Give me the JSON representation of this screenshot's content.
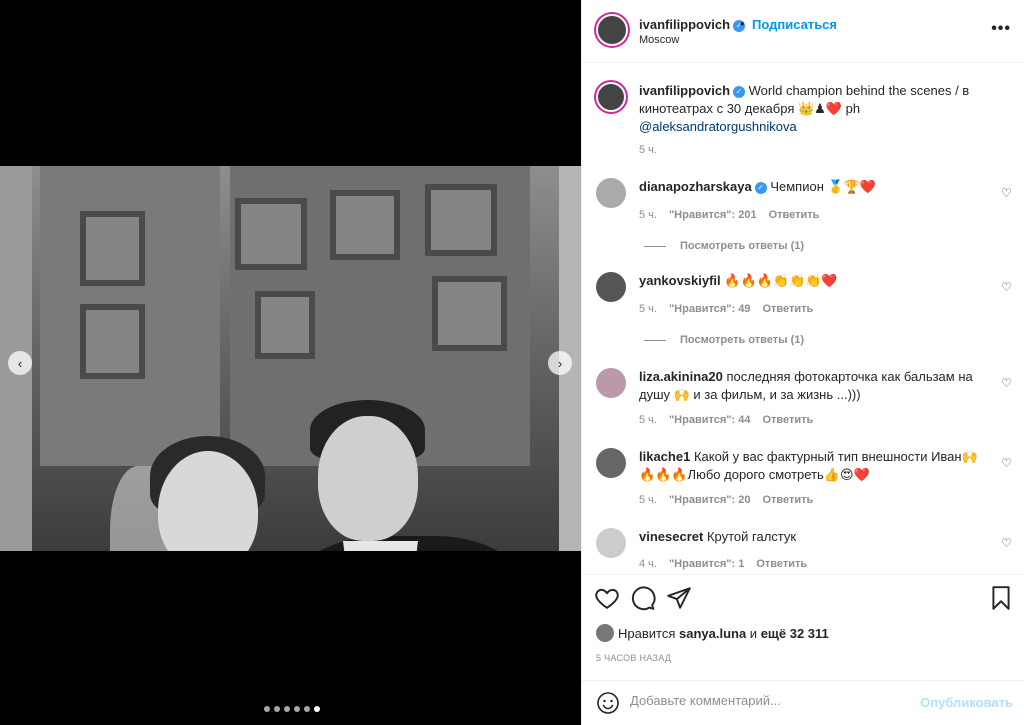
{
  "post": {
    "username": "ivanfilippovich",
    "follow_label": "Подписаться",
    "separator": "•",
    "location": "Moscow",
    "more_label": "•••",
    "nav_prev": "‹",
    "nav_next": "›",
    "carousel": {
      "count": 6,
      "active_index": 5
    }
  },
  "caption": {
    "username": "ivanfilippovich",
    "text": " World champion behind the scenes / в кинотеатрах с 30 декабря 👑♟❤️ ph ",
    "mention": "@aleksandratorgushnikova",
    "time": "5 ч."
  },
  "comments": [
    {
      "username": "dianapozharskaya",
      "verified": true,
      "text": " Чемпион 🥇🏆❤️",
      "time": "5 ч.",
      "likes": "\"Нравится\": 201",
      "reply": "Ответить",
      "replies": "Посмотреть ответы (1)"
    },
    {
      "username": "yankovskiyfil",
      "verified": false,
      "text": " 🔥🔥🔥👏👏👏❤️",
      "time": "5 ч.",
      "likes": "\"Нравится\": 49",
      "reply": "Ответить",
      "replies": "Посмотреть ответы (1)"
    },
    {
      "username": "liza.akinina20",
      "verified": false,
      "text": " последняя фотокарточка как бальзам на душу 🙌 и за фильм, и за жизнь ...)))",
      "time": "5 ч.",
      "likes": "\"Нравится\": 44",
      "reply": "Ответить",
      "replies": ""
    },
    {
      "username": "likache1",
      "verified": false,
      "text": " Какой у вас фактурный тип внешности Иван🙌🔥🔥🔥Любо дорого смотреть👍😍❤️",
      "time": "5 ч.",
      "likes": "\"Нравится\": 20",
      "reply": "Ответить",
      "replies": ""
    },
    {
      "username": "vinesecret",
      "verified": false,
      "text": " Крутой галстук",
      "time": "4 ч.",
      "likes": "\"Нравится\": 1",
      "reply": "Ответить",
      "replies": ""
    }
  ],
  "likes_line": {
    "prefix": "Нравится ",
    "user": "sanya.luna",
    "middle": " и ",
    "rest": "ещё 32 311"
  },
  "posted_ago": "5 ЧАСОВ НАЗАД",
  "comment_box": {
    "placeholder": "Добавьте комментарий...",
    "publish_label": "Опубликовать"
  },
  "icons": {
    "like": "heart-icon",
    "comment": "comment-icon",
    "share": "paper-plane-icon",
    "save": "bookmark-icon",
    "emoji": "smiley-icon",
    "verified": "verified-badge-icon"
  },
  "colors": {
    "accent": "#0095f6",
    "verified": "#3897f0",
    "muted": "#8e8e8e",
    "publish_disabled": "#b2dffc"
  }
}
